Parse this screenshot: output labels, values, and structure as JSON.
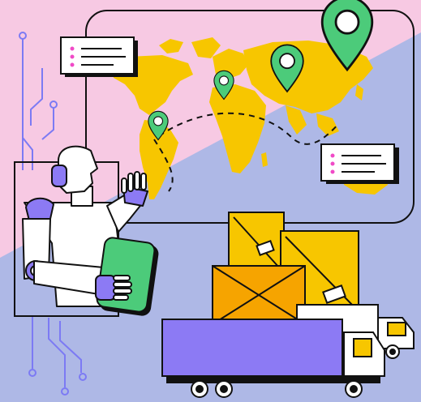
{
  "colors": {
    "pink_bg": "#F7C9E3",
    "blue_bg": "#AEB8E6",
    "outline": "#111111",
    "map_land": "#F7C600",
    "pin_green": "#4CCB7A",
    "robot_purple": "#8C7AF4",
    "truck_purple": "#8C7AF4",
    "box_orange": "#F6A400",
    "box_yellow": "#F7C600",
    "note_pink": "#F04AC7",
    "truck_window": "#F7C600",
    "circuit_line": "#7C7AF4"
  },
  "icons": [
    "world-map",
    "location-pin-icon",
    "dashed-route",
    "info-card",
    "robot-figure",
    "tablet",
    "stacked-boxes",
    "delivery-truck",
    "circuit-lines"
  ]
}
